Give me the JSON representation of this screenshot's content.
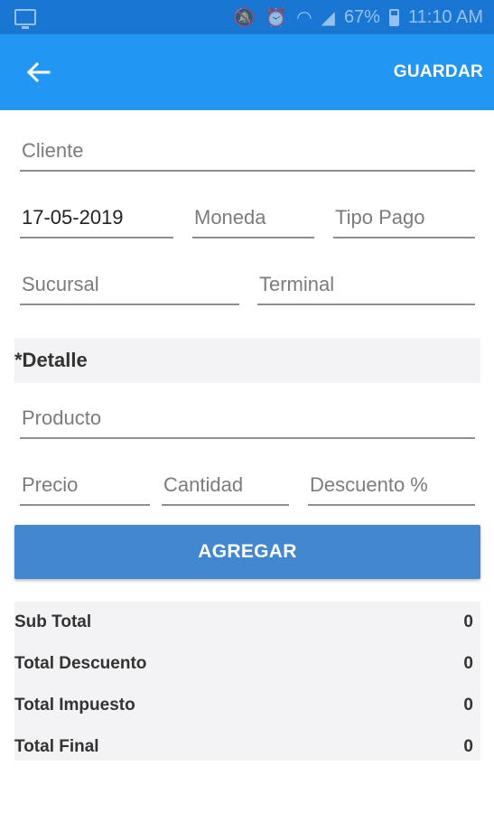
{
  "status_bar": {
    "battery": "67%",
    "time": "11:10 AM"
  },
  "app_bar": {
    "back_icon": "arrow-left-icon",
    "save_label": "GUARDAR"
  },
  "form": {
    "cliente": {
      "value": "",
      "placeholder": "Cliente"
    },
    "fecha": {
      "value": "17-05-2019",
      "placeholder": ""
    },
    "moneda": {
      "value": "",
      "placeholder": "Moneda"
    },
    "tipo_pago": {
      "value": "",
      "placeholder": "Tipo Pago"
    },
    "sucursal": {
      "value": "",
      "placeholder": "Sucursal"
    },
    "terminal": {
      "value": "",
      "placeholder": "Terminal"
    }
  },
  "detalle": {
    "title": "*Detalle",
    "producto": {
      "value": "",
      "placeholder": "Producto"
    },
    "precio": {
      "value": "",
      "placeholder": "Precio"
    },
    "cantidad": {
      "value": "",
      "placeholder": "Cantidad"
    },
    "descuento": {
      "value": "",
      "placeholder": "Descuento %"
    },
    "add_label": "AGREGAR"
  },
  "totals": {
    "rows": [
      {
        "label": "Sub Total",
        "value": "0"
      },
      {
        "label": "Total Descuento",
        "value": "0"
      },
      {
        "label": "Total Impuesto",
        "value": "0"
      },
      {
        "label": "Total Final",
        "value": "0"
      }
    ]
  },
  "colors": {
    "status_bar": "#1976d2",
    "app_bar": "#2196f3",
    "button": "#4188d0",
    "section_bg": "#f3f3f5"
  }
}
